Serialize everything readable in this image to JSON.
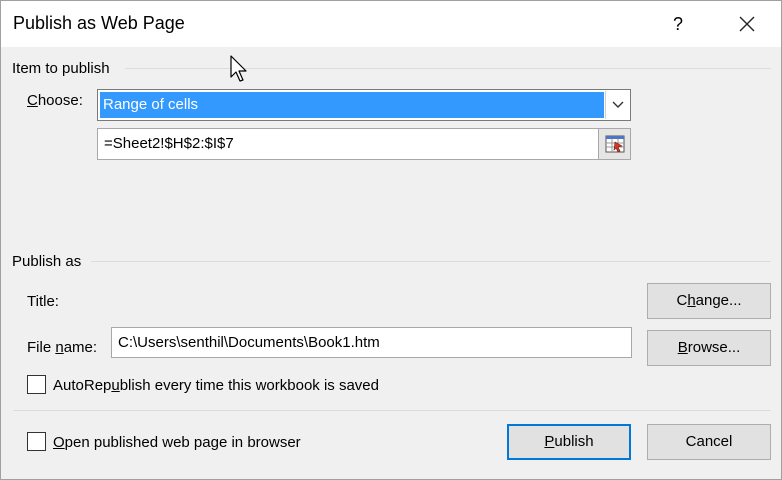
{
  "window": {
    "title": "Publish as Web Page",
    "help_label": "?"
  },
  "item_group": {
    "label": "Item to publish",
    "choose_label_pre": "",
    "choose_label_ul": "C",
    "choose_label_post": "hoose:",
    "choose_value": "Range of cells",
    "range_value": "=Sheet2!$H$2:$I$7"
  },
  "publish_group": {
    "label": "Publish as",
    "title_label": "Title:",
    "change_pre": "C",
    "change_ul": "h",
    "change_post": "ange...",
    "filename_pre": "File ",
    "filename_ul": "n",
    "filename_post": "ame:",
    "filename_value": "C:\\Users\\senthil\\Documents\\Book1.htm",
    "browse_pre": "",
    "browse_ul": "B",
    "browse_post": "rowse...",
    "autorepublish_pre": "AutoRep",
    "autorepublish_ul": "u",
    "autorepublish_post": "blish every time this workbook is saved",
    "autorepublish_checked": false
  },
  "footer": {
    "open_pre": "",
    "open_ul": "O",
    "open_post": "pen published web page in browser",
    "open_checked": false,
    "publish_pre": "",
    "publish_ul": "P",
    "publish_post": "ublish",
    "cancel_label": "Cancel"
  },
  "colors": {
    "selection": "#3399ff",
    "default_button_border": "#0078d7",
    "dialog_bg": "#f0f0f0"
  }
}
